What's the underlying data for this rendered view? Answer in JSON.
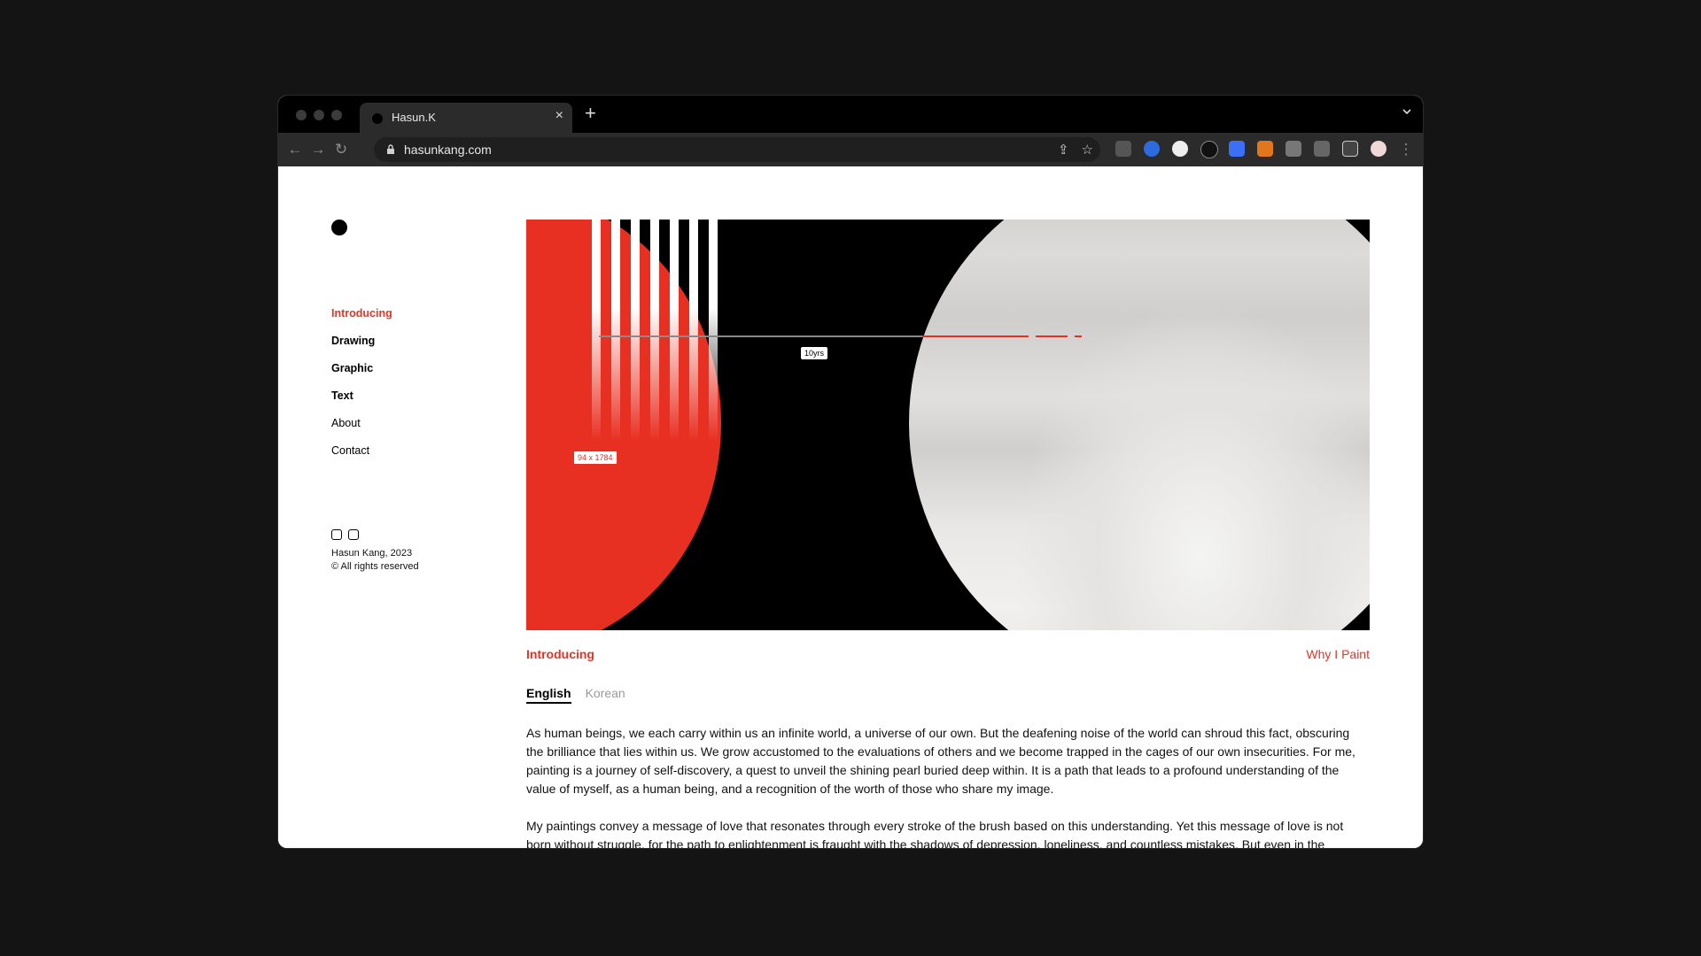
{
  "browser": {
    "tab_title": "Hasun.K",
    "url": "hasunkang.com"
  },
  "sidebar": {
    "nav": [
      {
        "label": "Introducing"
      },
      {
        "label": "Drawing"
      },
      {
        "label": "Graphic"
      },
      {
        "label": "Text"
      },
      {
        "label": "About"
      },
      {
        "label": "Contact"
      }
    ],
    "credit_line1": "Hasun Kang, 2023",
    "credit_line2": "© All rights reserved"
  },
  "hero": {
    "tag_years": "10yrs",
    "tag_size": "94 x 1784"
  },
  "section": {
    "title": "Introducing",
    "link": "Why I Paint"
  },
  "languages": {
    "english": "English",
    "korean": "Korean"
  },
  "content": {
    "paragraph1": "As human beings, we each carry within us an infinite world, a universe of our own. But the deafening noise of the world can shroud this fact, obscuring the brilliance that lies within us. We grow accustomed to the evaluations of others and we become trapped in the cages of our own insecurities. For me, painting is a journey of self-discovery, a quest to unveil the shining pearl buried deep within. It is a path that leads to a profound understanding of the value of myself, as a human being, and a recognition of the worth of those who share my image.",
    "paragraph2": "My paintings convey a message of love that resonates through every stroke of the brush based on this understanding. Yet this message of love is not born without struggle, for the path to enlightenment is fraught with the shadows of depression, loneliness, and countless mistakes. But even in the"
  },
  "colors": {
    "accent": "#e63323",
    "background": "#141414"
  }
}
